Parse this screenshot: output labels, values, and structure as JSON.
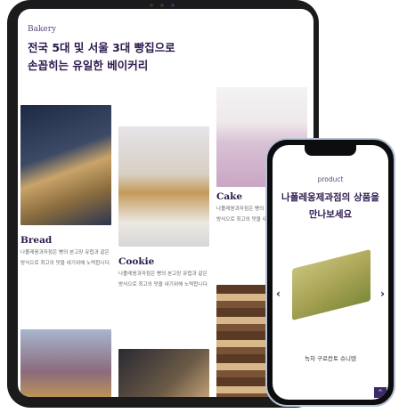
{
  "tablet": {
    "eyebrow": "Bakery",
    "title_line1": "전국 5대 및 서울 3대 빵집으로",
    "title_line2": "손꼽히는 유일한 베이커리",
    "products": [
      {
        "name": "Bread",
        "desc": "나폴레옹과자점은 빵의 본고장 유럽과 같은 방식으로 최고의 맛을 내기위해 노력합니다."
      },
      {
        "name": "Cookie",
        "desc": "나폴레옹과자점은 빵의 본고장 유럽과 같은 방식으로 최고의 맛을 내기위해 노력합니다."
      },
      {
        "name": "Cake",
        "desc": "나폴레옹과자점은 빵의 본고장 유럽과 같은 방식으로 최고의 맛을 내기위해 노력합니다."
      }
    ]
  },
  "phone": {
    "eyebrow": "product",
    "title_line1": "나폴레옹제과점의 상품을",
    "title_line2": "만나보세요",
    "prev": "‹",
    "next": "›",
    "product_name": "녹차 구로칸토 슈니텐",
    "top_button": "^"
  }
}
